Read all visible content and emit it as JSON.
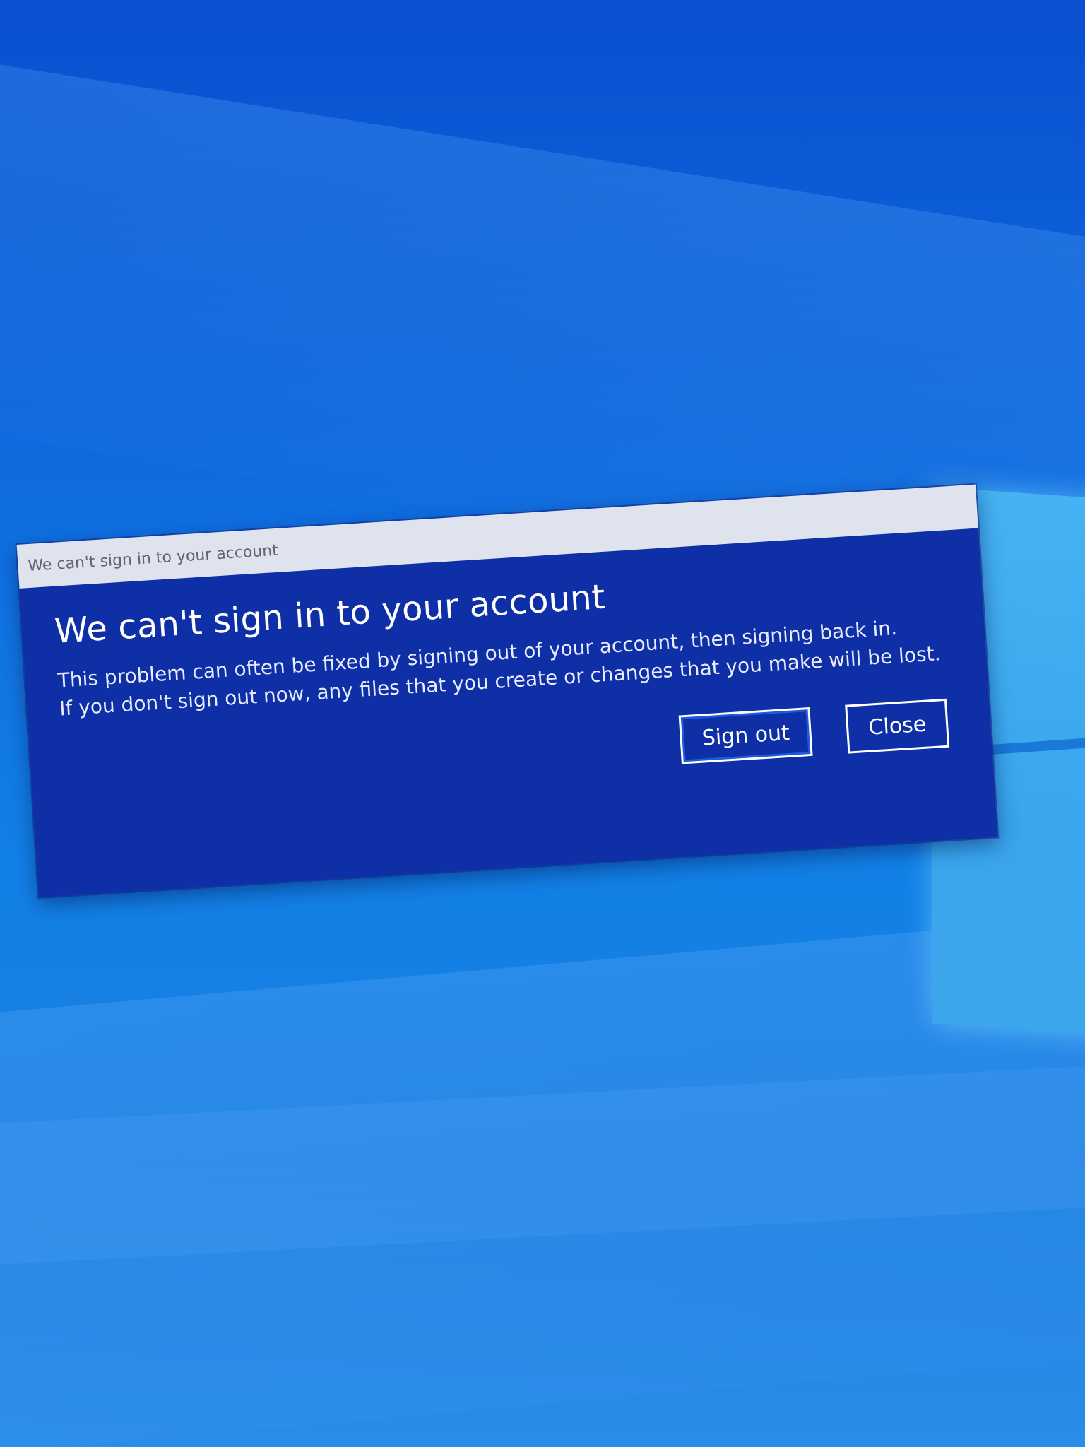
{
  "dialog": {
    "window_title": "We can't sign in to your account",
    "heading": "We can't sign in to your account",
    "message_line_1": "This problem can often be fixed by signing out of your account, then signing back in.",
    "message_line_2": "If you don't sign out now, any files that you create or changes that you make will be lost.",
    "buttons": {
      "sign_out": "Sign out",
      "close": "Close"
    }
  },
  "colors": {
    "dialog_background": "#0f2fa6",
    "titlebar_background": "#dfe3ee",
    "desktop_blue": "#1280e6"
  },
  "icons": {
    "desktop_logo": "windows-logo-icon"
  }
}
